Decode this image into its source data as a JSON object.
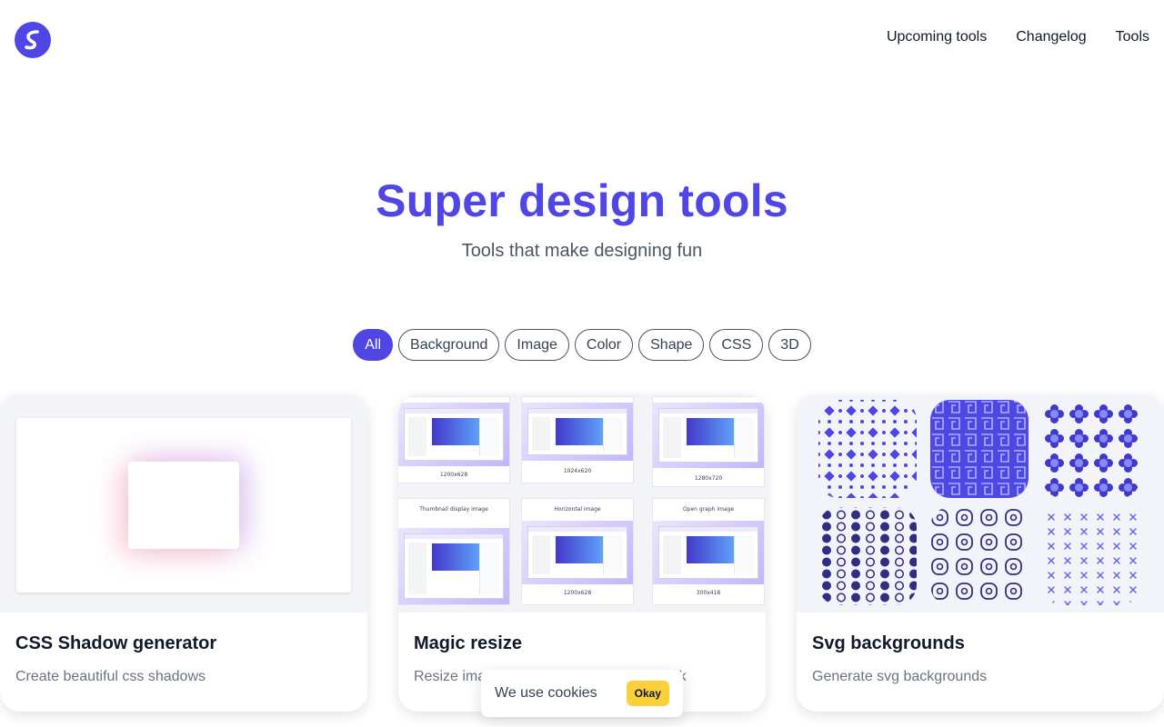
{
  "header": {
    "logo_icon": "s-logo-icon",
    "brand_color": "#4f46e5",
    "nav": [
      {
        "label": "Upcoming tools"
      },
      {
        "label": "Changelog"
      },
      {
        "label": "Tools"
      }
    ]
  },
  "hero": {
    "title": "Super design tools",
    "subtitle": "Tools that make designing fun"
  },
  "filters": [
    {
      "label": "All",
      "active": true
    },
    {
      "label": "Background"
    },
    {
      "label": "Image"
    },
    {
      "label": "Color"
    },
    {
      "label": "Shape"
    },
    {
      "label": "CSS"
    },
    {
      "label": "3D"
    }
  ],
  "cards": [
    {
      "title": "CSS Shadow generator",
      "description": "Create beautiful css shadows"
    },
    {
      "title": "Magic resize",
      "description": "Resize images for every platform in a click",
      "thumbs": [
        {
          "caption": "1200x628"
        },
        {
          "caption": "1024x620"
        },
        {
          "caption": "1280x720"
        },
        {
          "caption": "Thumbnail display image"
        },
        {
          "caption": "Horizontal image"
        },
        {
          "caption": "Open graph image"
        },
        {
          "caption": "1200x628"
        },
        {
          "caption": "300x418"
        }
      ]
    },
    {
      "title": "Svg backgrounds",
      "description": "Generate svg backgrounds"
    }
  ],
  "cookie": {
    "text": "We use cookies",
    "button": "Okay",
    "button_color": "#fbd038"
  }
}
